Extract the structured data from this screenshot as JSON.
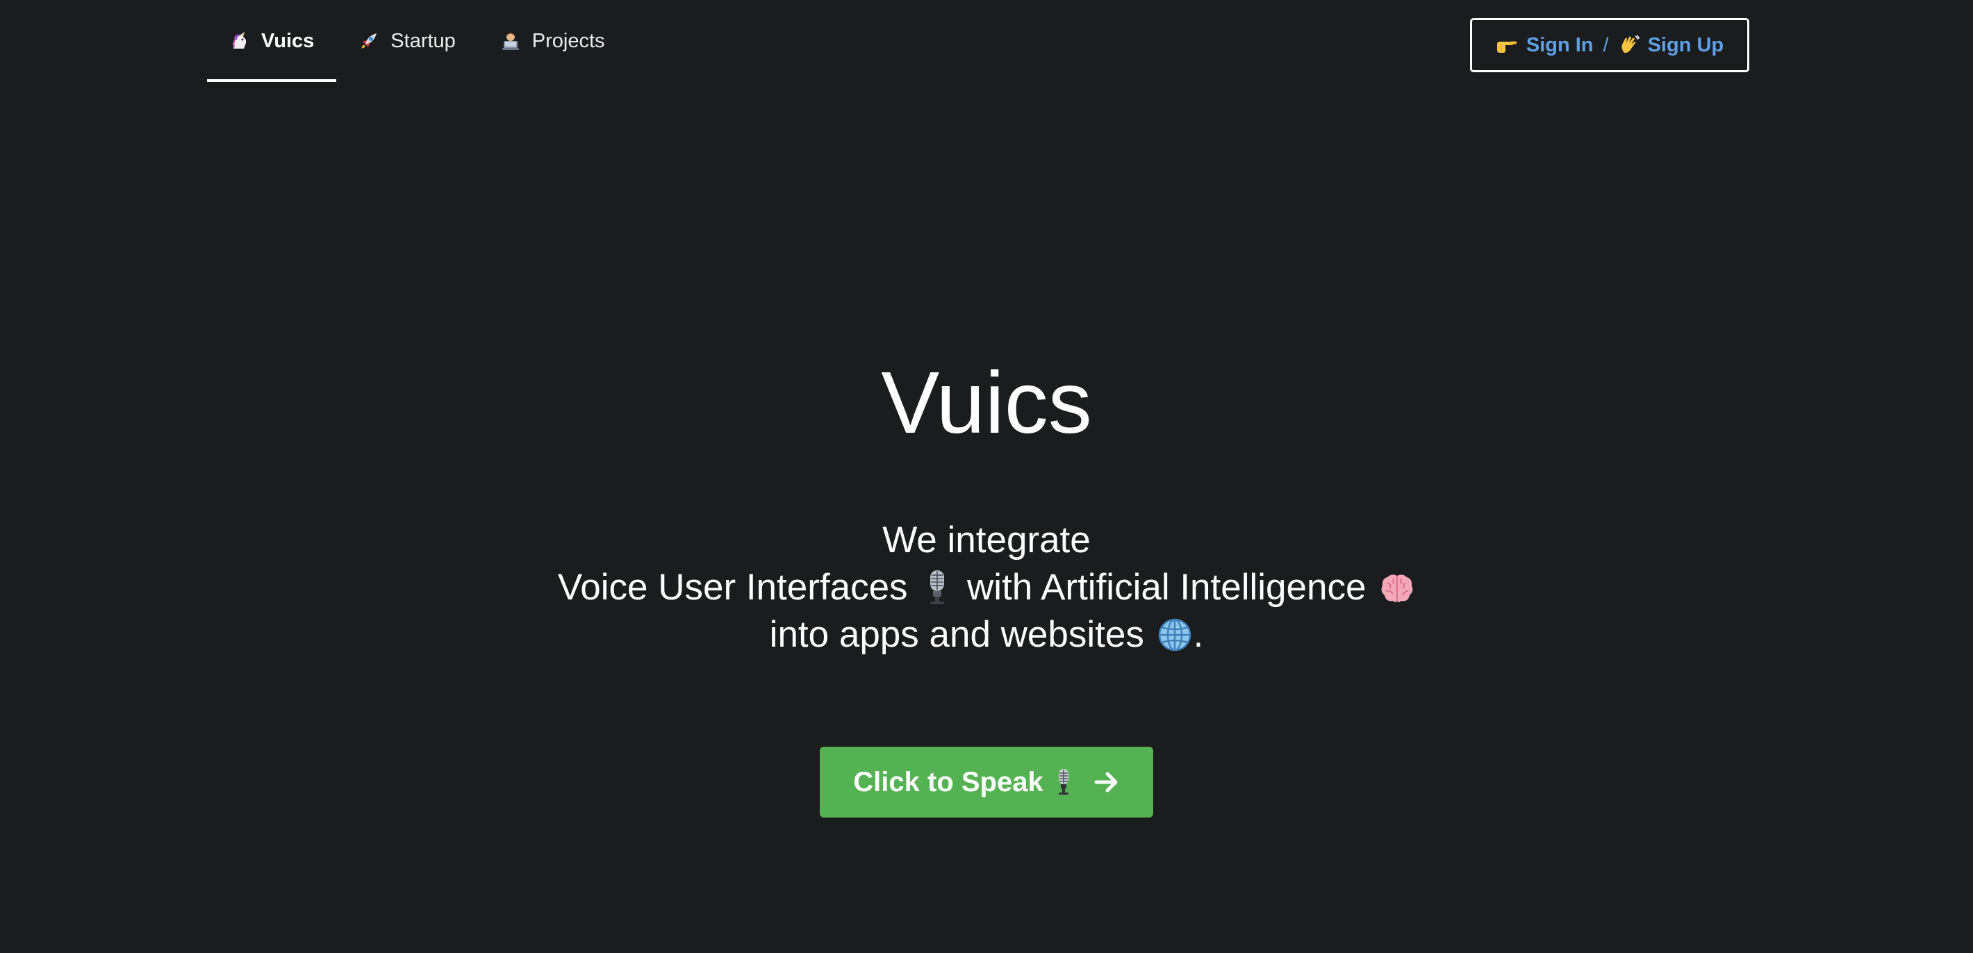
{
  "nav": {
    "items": [
      {
        "label": "Vuics",
        "icon": "unicorn-icon",
        "active": true
      },
      {
        "label": "Startup",
        "icon": "rocket-icon",
        "active": false
      },
      {
        "label": "Projects",
        "icon": "technologist-icon",
        "active": false
      }
    ]
  },
  "auth": {
    "sign_in_label": "Sign In",
    "separator": "/",
    "sign_up_label": "Sign Up",
    "sign_in_icon": "pointing-hand-icon",
    "sign_up_icon": "waving-hand-icon"
  },
  "hero": {
    "title": "Vuics",
    "line1": "We integrate",
    "line2_a": "Voice User Interfaces",
    "line2_b": "with Artificial Intelligence",
    "line3_a": "into apps and websites",
    "line3_b": "."
  },
  "cta": {
    "label": "Click to Speak",
    "icon": "microphone-icon",
    "arrow_icon": "arrow-right-icon"
  },
  "colors": {
    "background": "#1b1c1d",
    "link": "#5ea0e6",
    "cta_green": "#54b253",
    "text": "#ffffff"
  }
}
